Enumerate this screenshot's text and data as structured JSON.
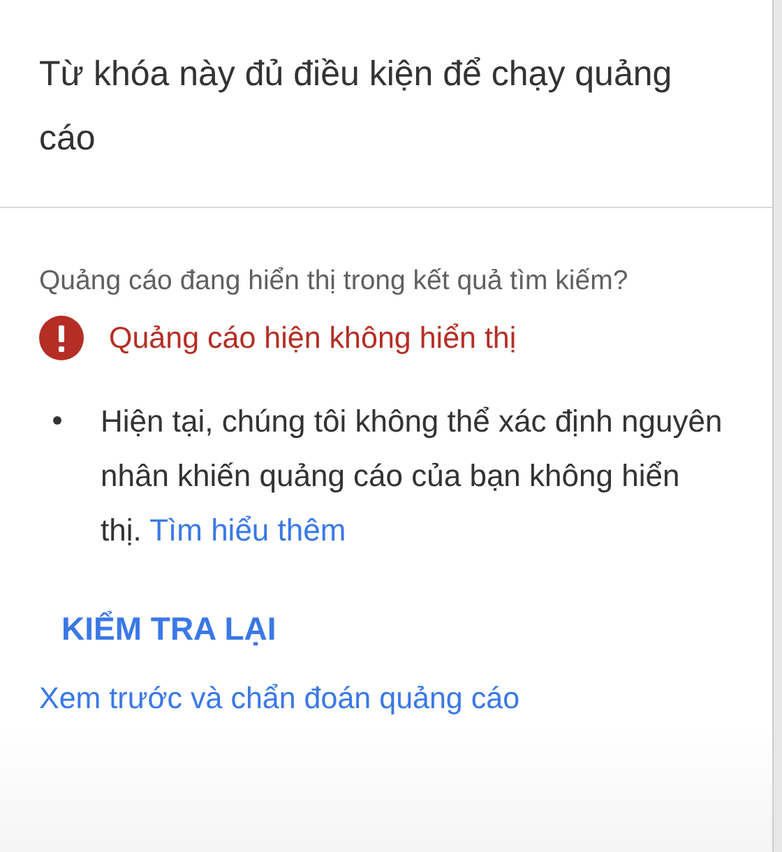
{
  "title": "Từ khóa này đủ điều kiện để chạy quảng cáo",
  "question": "Quảng cáo đang hiển thị trong kết quả tìm kiếm?",
  "status": {
    "kind": "error",
    "text": "Quảng cáo hiện không hiển thị"
  },
  "reasons": [
    {
      "text": "Hiện tại, chúng tôi không thể xác định nguyên nhân khiến quảng cáo của bạn không hiển thị.",
      "link": "Tìm hiểu thêm"
    }
  ],
  "recheck_button": "KIỂM TRA LẠI",
  "preview_link": "Xem trước và chẩn đoán quảng cáo"
}
